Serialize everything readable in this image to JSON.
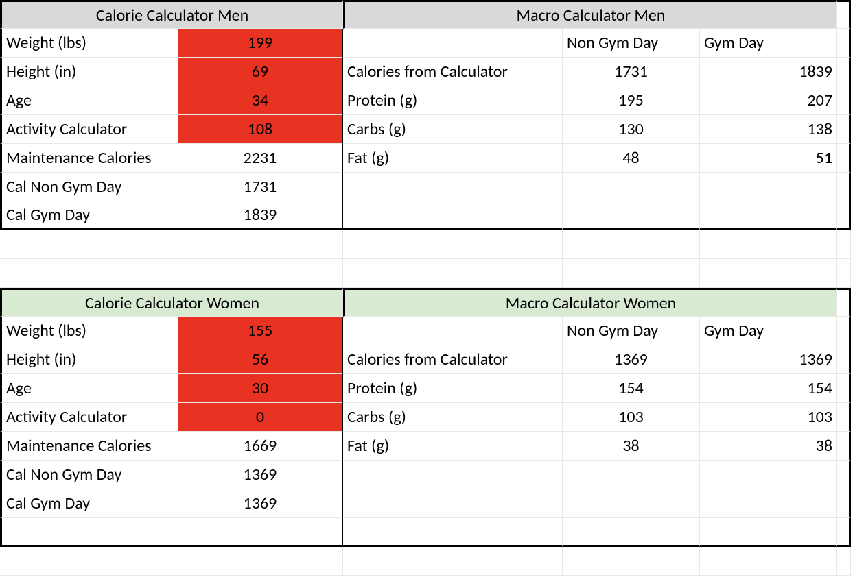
{
  "sections": {
    "men_cal": {
      "title": "Calorie Calculator Men",
      "rows": [
        {
          "label": "Weight (lbs)",
          "value": "199",
          "input": true
        },
        {
          "label": "Height (in)",
          "value": "69",
          "input": true
        },
        {
          "label": "Age",
          "value": "34",
          "input": true
        },
        {
          "label": "Activity Calculator",
          "value": "108",
          "input": true
        },
        {
          "label": "Maintenance Calories",
          "value": "2231",
          "input": false
        },
        {
          "label": "Cal Non Gym Day",
          "value": "1731",
          "input": false
        },
        {
          "label": "Cal Gym Day",
          "value": "1839",
          "input": false
        }
      ]
    },
    "men_macro": {
      "title": "Macro Calculator Men",
      "col_labels": {
        "c1": "Non Gym Day",
        "c2": "Gym Day"
      },
      "rows": [
        {
          "label": "Calories from Calculator",
          "v1": "1731",
          "v2": "1839"
        },
        {
          "label": "Protein (g)",
          "v1": "195",
          "v2": "207"
        },
        {
          "label": "Carbs (g)",
          "v1": "130",
          "v2": "138"
        },
        {
          "label": "Fat (g)",
          "v1": "48",
          "v2": "51"
        }
      ]
    },
    "women_cal": {
      "title": "Calorie Calculator Women",
      "rows": [
        {
          "label": "Weight (lbs)",
          "value": "155",
          "input": true
        },
        {
          "label": "Height (in)",
          "value": "56",
          "input": true
        },
        {
          "label": "Age",
          "value": "30",
          "input": true
        },
        {
          "label": "Activity Calculator",
          "value": "0",
          "input": true
        },
        {
          "label": "Maintenance Calories",
          "value": "1669",
          "input": false
        },
        {
          "label": "Cal Non Gym Day",
          "value": "1369",
          "input": false
        },
        {
          "label": "Cal Gym Day",
          "value": "1369",
          "input": false
        }
      ]
    },
    "women_macro": {
      "title": "Macro Calculator Women",
      "col_labels": {
        "c1": "Non Gym Day",
        "c2": "Gym Day"
      },
      "rows": [
        {
          "label": "Calories from Calculator",
          "v1": "1369",
          "v2": "1369"
        },
        {
          "label": "Protein (g)",
          "v1": "154",
          "v2": "154"
        },
        {
          "label": "Carbs (g)",
          "v1": "103",
          "v2": "103"
        },
        {
          "label": "Fat (g)",
          "v1": "38",
          "v2": "38"
        }
      ]
    }
  },
  "colors": {
    "header_gray": "#d9d9d9",
    "header_green": "#d9ead3",
    "input_red": "#e83323"
  }
}
